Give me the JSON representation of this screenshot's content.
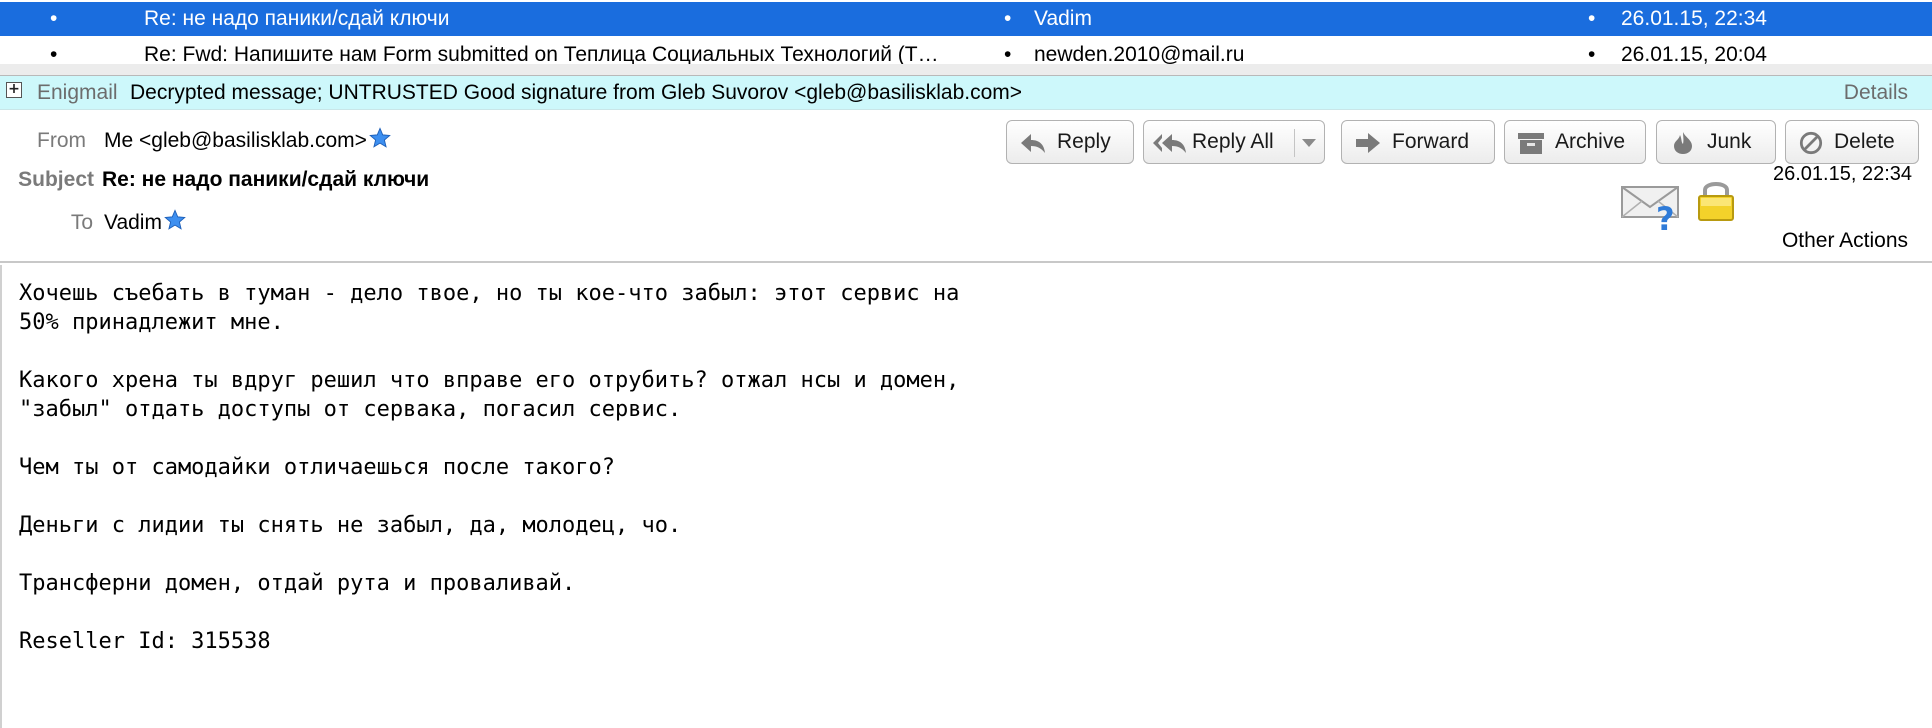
{
  "message_list": {
    "rows": [
      {
        "subject": "Re: не надо паники/сдай ключи",
        "sender": "Vadim",
        "date": "26.01.15, 22:34",
        "selected": true
      },
      {
        "subject": "Re: Fwd: Напишите нам Form submitted on Теплица Социальных Технологий (Т…",
        "sender": "newden.2010@mail.ru",
        "date": "26.01.15, 20:04",
        "selected": false
      }
    ],
    "selected_color": "#1a6dde"
  },
  "enigmail": {
    "toggle": "+",
    "label": "Enigmail",
    "status": "Decrypted message; UNTRUSTED Good signature from Gleb Suvorov <gleb@basilisklab.com>",
    "details": "Details",
    "background": "#cdf8fb"
  },
  "header": {
    "from_label": "From",
    "from_value": "Me <gleb@basilisklab.com>",
    "subject_label": "Subject",
    "subject_value": "Re: не надо паники/сдай ключи",
    "to_label": "To",
    "to_value": "Vadim",
    "date": "26.01.15, 22:34",
    "other_actions": "Other Actions"
  },
  "toolbar": {
    "reply": "Reply",
    "reply_all": "Reply All",
    "forward": "Forward",
    "archive": "Archive",
    "junk": "Junk",
    "delete": "Delete"
  },
  "icons": {
    "star": "star-icon",
    "signature_status": "envelope-question-icon",
    "encryption_status": "padlock-icon"
  },
  "body": {
    "text": "Хочешь съебать в туман - дело твое, но ты кое-что забыл: этот сервис на\n50% принадлежит мне.\n\nКакого хрена ты вдруг решил что вправе его отрубить? отжал нсы и домен,\n\"забыл\" отдать доступы от сервака, погасил сервис.\n\nЧем ты от самодайки отличаешься после такого?\n\nДеньги с лидии ты снять не забыл, да, молодец, чо.\n\nТрансферни домен, отдай рута и проваливай.\n\nReseller Id: 315538"
  }
}
